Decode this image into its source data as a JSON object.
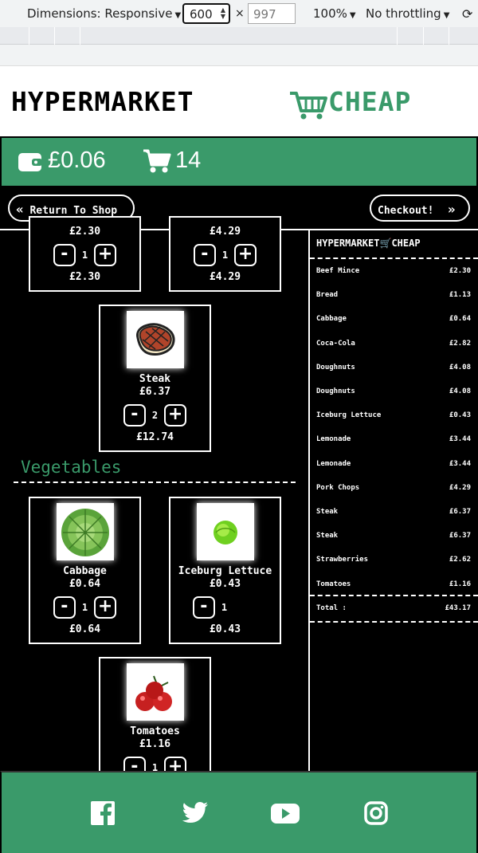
{
  "devtools": {
    "dimensions_label": "Dimensions: Responsive",
    "width": "600",
    "height": "997",
    "zoom": "100%",
    "throttling": "No throttling"
  },
  "header": {
    "logo_left": "HYPERMARKET",
    "logo_right": "CHEAP",
    "wallet": "£0.06",
    "cart_count": "14",
    "brand_green": "#3a9a6a"
  },
  "nav": {
    "return_label": "Return To Shop",
    "checkout_label": "Checkout!"
  },
  "products": [
    {
      "name": "",
      "price": "£2.30",
      "qty": "1",
      "total": "£2.30"
    },
    {
      "name": "",
      "price": "£4.29",
      "qty": "1",
      "total": "£4.29"
    },
    {
      "name": "Steak",
      "price": "£6.37",
      "qty": "2",
      "total": "£12.74",
      "icon": "steak-icon"
    },
    {
      "name": "Cabbage",
      "price": "£0.64",
      "qty": "1",
      "total": "£0.64",
      "icon": "cabbage-icon"
    },
    {
      "name": "Iceburg Lettuce",
      "price": "£0.43",
      "qty": "1",
      "total": "£0.43",
      "icon": "lettuce-icon"
    },
    {
      "name": "Tomatoes",
      "price": "£1.16",
      "qty": "1",
      "icon": "tomato-icon"
    }
  ],
  "section": {
    "vegetables": "Vegetables"
  },
  "receipt": {
    "logo_left": "HYPERMARKET",
    "logo_right": "CHEAP",
    "items": [
      {
        "name": "Beef Mince",
        "price": "£2.30"
      },
      {
        "name": "Bread",
        "price": "£1.13"
      },
      {
        "name": "Cabbage",
        "price": "£0.64"
      },
      {
        "name": "Coca-Cola",
        "price": "£2.82"
      },
      {
        "name": "Doughnuts",
        "price": "£4.08"
      },
      {
        "name": "Doughnuts",
        "price": "£4.08"
      },
      {
        "name": "Iceburg Lettuce",
        "price": "£0.43"
      },
      {
        "name": "Lemonade",
        "price": "£3.44"
      },
      {
        "name": "Lemonade",
        "price": "£3.44"
      },
      {
        "name": "Pork Chops",
        "price": "£4.29"
      },
      {
        "name": "Steak",
        "price": "£6.37"
      },
      {
        "name": "Steak",
        "price": "£6.37"
      },
      {
        "name": "Strawberries",
        "price": "£2.62"
      },
      {
        "name": "Tomatoes",
        "price": "£1.16"
      }
    ],
    "total_label": "Total :",
    "total_value": "£43.17"
  },
  "footer": {
    "icons": [
      "facebook-icon",
      "twitter-icon",
      "youtube-icon",
      "instagram-icon"
    ]
  }
}
